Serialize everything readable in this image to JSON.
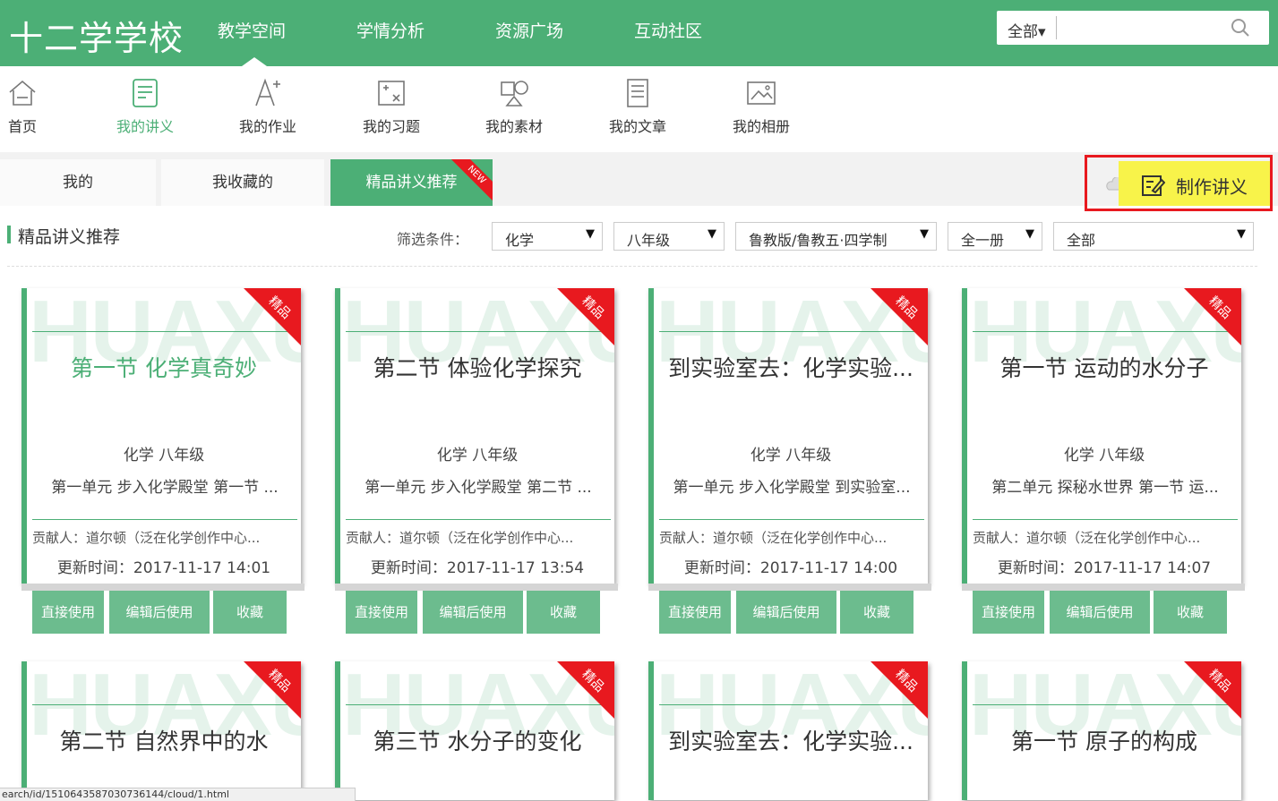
{
  "header": {
    "logo": "十二学学校",
    "nav": [
      "教学空间",
      "学情分析",
      "资源广场",
      "互动社区"
    ],
    "search": {
      "scope": "全部",
      "placeholder": ""
    }
  },
  "subnav": [
    {
      "label": "首页",
      "icon": "home-icon"
    },
    {
      "label": "我的讲义",
      "icon": "lecture-icon"
    },
    {
      "label": "我的作业",
      "icon": "homework-icon"
    },
    {
      "label": "我的习题",
      "icon": "exercise-icon"
    },
    {
      "label": "我的素材",
      "icon": "material-icon"
    },
    {
      "label": "我的文章",
      "icon": "article-icon"
    },
    {
      "label": "我的相册",
      "icon": "album-icon"
    }
  ],
  "tabs": [
    "我的",
    "我收藏的",
    "精品讲义推荐"
  ],
  "tab_badge": "NEW",
  "make_button": "制作讲义",
  "section_title": "精品讲义推荐",
  "filter": {
    "label": "筛选条件：",
    "values": [
      "化学",
      "八年级",
      "鲁教版/鲁教五·四学制",
      "全一册",
      "全部"
    ]
  },
  "card_ribbon": "精品",
  "watermark": "HUAXUE",
  "action_buttons": [
    "直接使用",
    "编辑后使用",
    "收藏"
  ],
  "cards": [
    {
      "title": "第一节 化学真奇妙",
      "subject": "化学  八年级",
      "unit": "第一单元 步入化学殿堂  第一节 ...",
      "contributor": "贡献人：道尔顿（泛在化学创作中心...",
      "time": "更新时间：2017-11-17 14:01"
    },
    {
      "title": "第二节 体验化学探究",
      "subject": "化学  八年级",
      "unit": "第一单元 步入化学殿堂  第二节 ...",
      "contributor": "贡献人：道尔顿（泛在化学创作中心...",
      "time": "更新时间：2017-11-17 13:54"
    },
    {
      "title": "到实验室去：化学实验...",
      "subject": "化学  八年级",
      "unit": "第一单元 步入化学殿堂  到实验室...",
      "contributor": "贡献人：道尔顿（泛在化学创作中心...",
      "time": "更新时间：2017-11-17 14:00"
    },
    {
      "title": "第一节 运动的水分子",
      "subject": "化学  八年级",
      "unit": "第二单元 探秘水世界  第一节 运...",
      "contributor": "贡献人：道尔顿（泛在化学创作中心...",
      "time": "更新时间：2017-11-17 14:07"
    },
    {
      "title": "第二节 自然界中的水"
    },
    {
      "title": "第三节 水分子的变化"
    },
    {
      "title": "到实验室去：化学实验..."
    },
    {
      "title": "第一节 原子的构成"
    }
  ],
  "status_url": "earch/id/151064358703073614​4/cloud/1.html",
  "colors": {
    "primary": "#4caf76",
    "highlight": "#f8f34a",
    "ribbon": "#e8191f",
    "button": "#6cbc8e"
  }
}
